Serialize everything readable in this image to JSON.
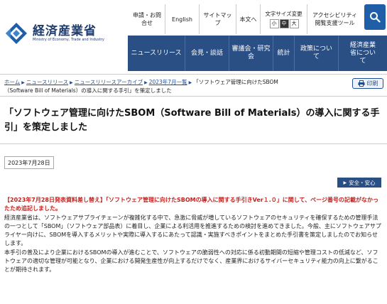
{
  "header": {
    "logo_title": "経済産業省",
    "logo_subtitle": "Ministry of Economy, Trade and Industry",
    "utility_links": [
      {
        "label": "申請・お問合せ"
      },
      {
        "label": "English"
      },
      {
        "label": "サイトマップ"
      },
      {
        "label": "本文へ"
      }
    ],
    "font_size": {
      "label": "文字サイズ変更",
      "small": "小",
      "medium": "中",
      "large": "大"
    },
    "accessibility": "アクセシビリティ閲覧支援ツール",
    "search_icon": "search-icon"
  },
  "nav": {
    "items": [
      {
        "label": "ニュースリリース"
      },
      {
        "label": "会見・談話"
      },
      {
        "label": "審議会・研究会"
      },
      {
        "label": "統計"
      },
      {
        "label": "政策について"
      },
      {
        "label": "経済産業省について"
      }
    ]
  },
  "breadcrumb": {
    "home": "ホーム",
    "news": "ニュースリリース",
    "archive": "ニュースリリースアーカイブ",
    "month": "2023年7月一覧",
    "current": "「ソフトウェア管理に向けたSBOM（Software Bill of Materials）の導入に関する手引」を策定しました"
  },
  "print_label": "印刷",
  "page_title": "「ソフトウェア管理に向けたSBOM（Software Bill of Materials）の導入に関する手引」を策定しました",
  "date": "2023年7月28日",
  "tag": "安全・安心",
  "notice": "【2023年7月28日発表資料差し替え】「ソフトウェア管理に向けたSBOMの導入に関する手引きVer１.０」に関して、ページ番号の記載がなかったため追記しました。",
  "paragraph1": "経済産業省は、ソフトウェアサプライチェーンが複雑化する中で、急激に脅威が増しているソフトウェアのセキュリティを確保するための管理手法の一つとして「SBOM」（ソフトウェア部品表）に着目し、企業による利活用を推進するための検討を進めてきました。今般、主にソフトウェアサプライヤー向けに、SBOMを導入するメリットや実際に導入するにあたって認識・実施すべきポイントをまとめた手引書を策定しましたのでお知らせします。",
  "paragraph2": "本手引の普及により企業におけるSBOMの導入が進むことで、ソフトウェアの脆弱性への対応に係る初動期間の短縮や管理コストの低減など、ソフトウェアの適切な管理が可能となり、企業における開発生産性が向上するだけでなく、産業界におけるサイバーセキュリティ能力の向上に繋がることが期待されます。",
  "colors": {
    "nav_bg": "#2a4f85",
    "link": "#1f4e96",
    "notice": "#c0221f",
    "brand": "#1e3b6d"
  }
}
